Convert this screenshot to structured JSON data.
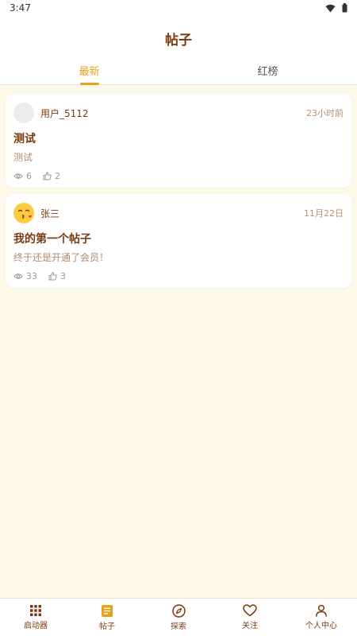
{
  "status_bar": {
    "time": "3:47"
  },
  "header": {
    "title": "帖子"
  },
  "tabs": [
    {
      "label": "最新",
      "active": true
    },
    {
      "label": "红榜",
      "active": false
    }
  ],
  "posts": [
    {
      "author": "用户_5112",
      "time": "23小时前",
      "title": "测试",
      "body": "测试",
      "views": "6",
      "likes": "2",
      "avatar": "blank"
    },
    {
      "author": "张三",
      "time": "11月22日",
      "title": "我的第一个帖子",
      "body": "终于还是开通了会员！",
      "views": "33",
      "likes": "3",
      "avatar": "kiss-emoji"
    }
  ],
  "bottom_nav": [
    {
      "label": "启动器",
      "icon": "grid-icon"
    },
    {
      "label": "帖子",
      "icon": "document-icon",
      "active": true
    },
    {
      "label": "探索",
      "icon": "compass-icon"
    },
    {
      "label": "关注",
      "icon": "heart-icon"
    },
    {
      "label": "个人中心",
      "icon": "person-icon"
    }
  ],
  "colors": {
    "accent": "#e6a21a",
    "brown": "#7a3a10",
    "background": "#fdf9e8"
  }
}
